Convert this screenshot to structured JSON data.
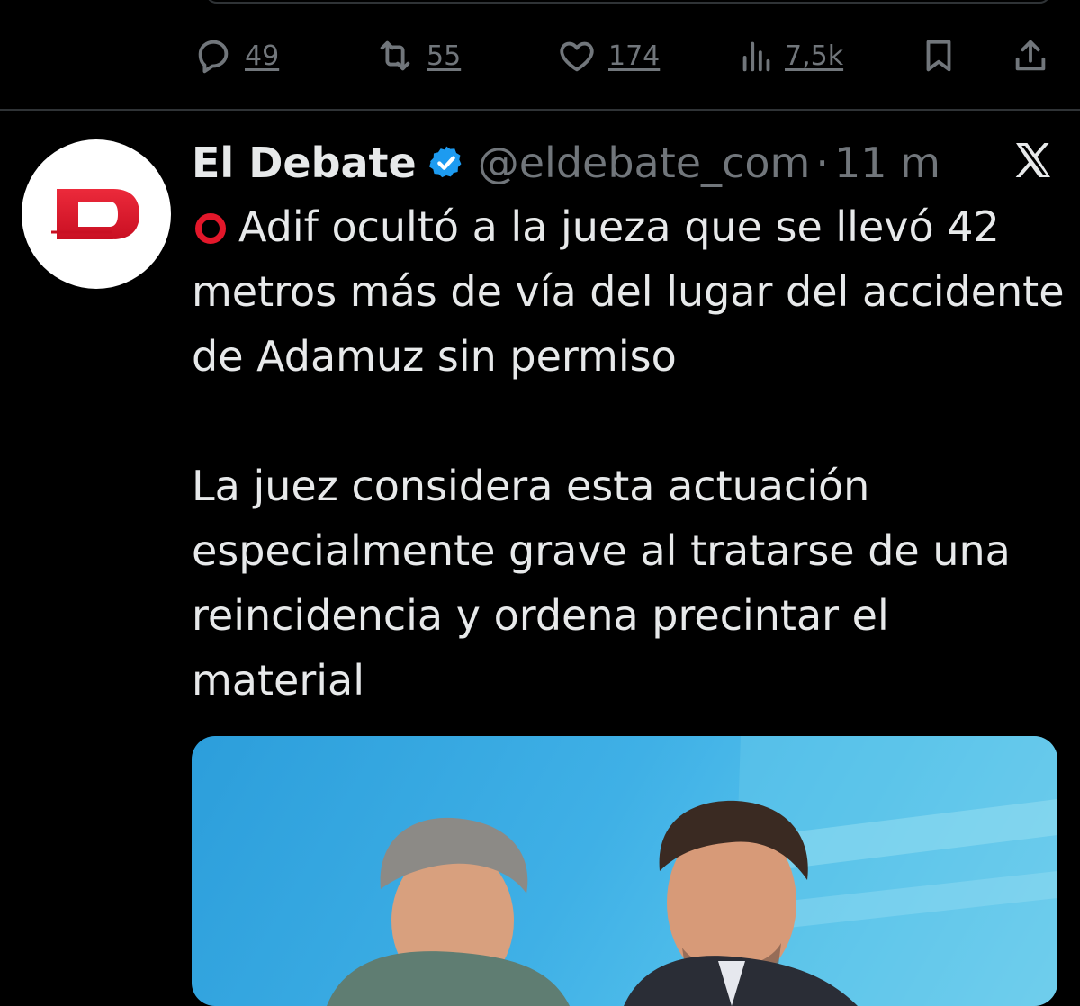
{
  "prev_tweet": {
    "actions": [
      {
        "id": "reply",
        "icon": "reply-icon",
        "count": "49"
      },
      {
        "id": "retweet",
        "icon": "retweet-icon",
        "count": "55"
      },
      {
        "id": "like",
        "icon": "like-icon",
        "count": "174"
      },
      {
        "id": "views",
        "icon": "views-icon",
        "count": "7,5k"
      },
      {
        "id": "bookmark",
        "icon": "bookmark-icon",
        "count": ""
      },
      {
        "id": "share",
        "icon": "share-icon",
        "count": ""
      }
    ]
  },
  "tweet": {
    "author": {
      "display_name": "El Debate",
      "handle": "@eldebate_com",
      "verified": true,
      "avatar_icon": "el-debate-logo",
      "logo_color": "#e3172a"
    },
    "separator": "·",
    "timestamp": "11 m",
    "platform_icon": "x-logo-icon",
    "text": {
      "line_prefix_icon": "red-circle-icon",
      "paragraph1": "Adif ocultó a la jueza que se llevó 42 metros más de vía del lugar del accidente de Adamuz sin permiso",
      "paragraph2": "La juez considera esta actuación especialmente grave al tratarse de una reincidencia y ordena precintar el material"
    },
    "media": {
      "kind": "photo",
      "description_icon": "news-photo"
    }
  },
  "colors": {
    "background": "#000000",
    "text_primary": "#e7e9ea",
    "text_secondary": "#71767b",
    "divider": "#2f3336",
    "verified_blue": "#1d9bf0",
    "accent_red": "#e3172a"
  }
}
